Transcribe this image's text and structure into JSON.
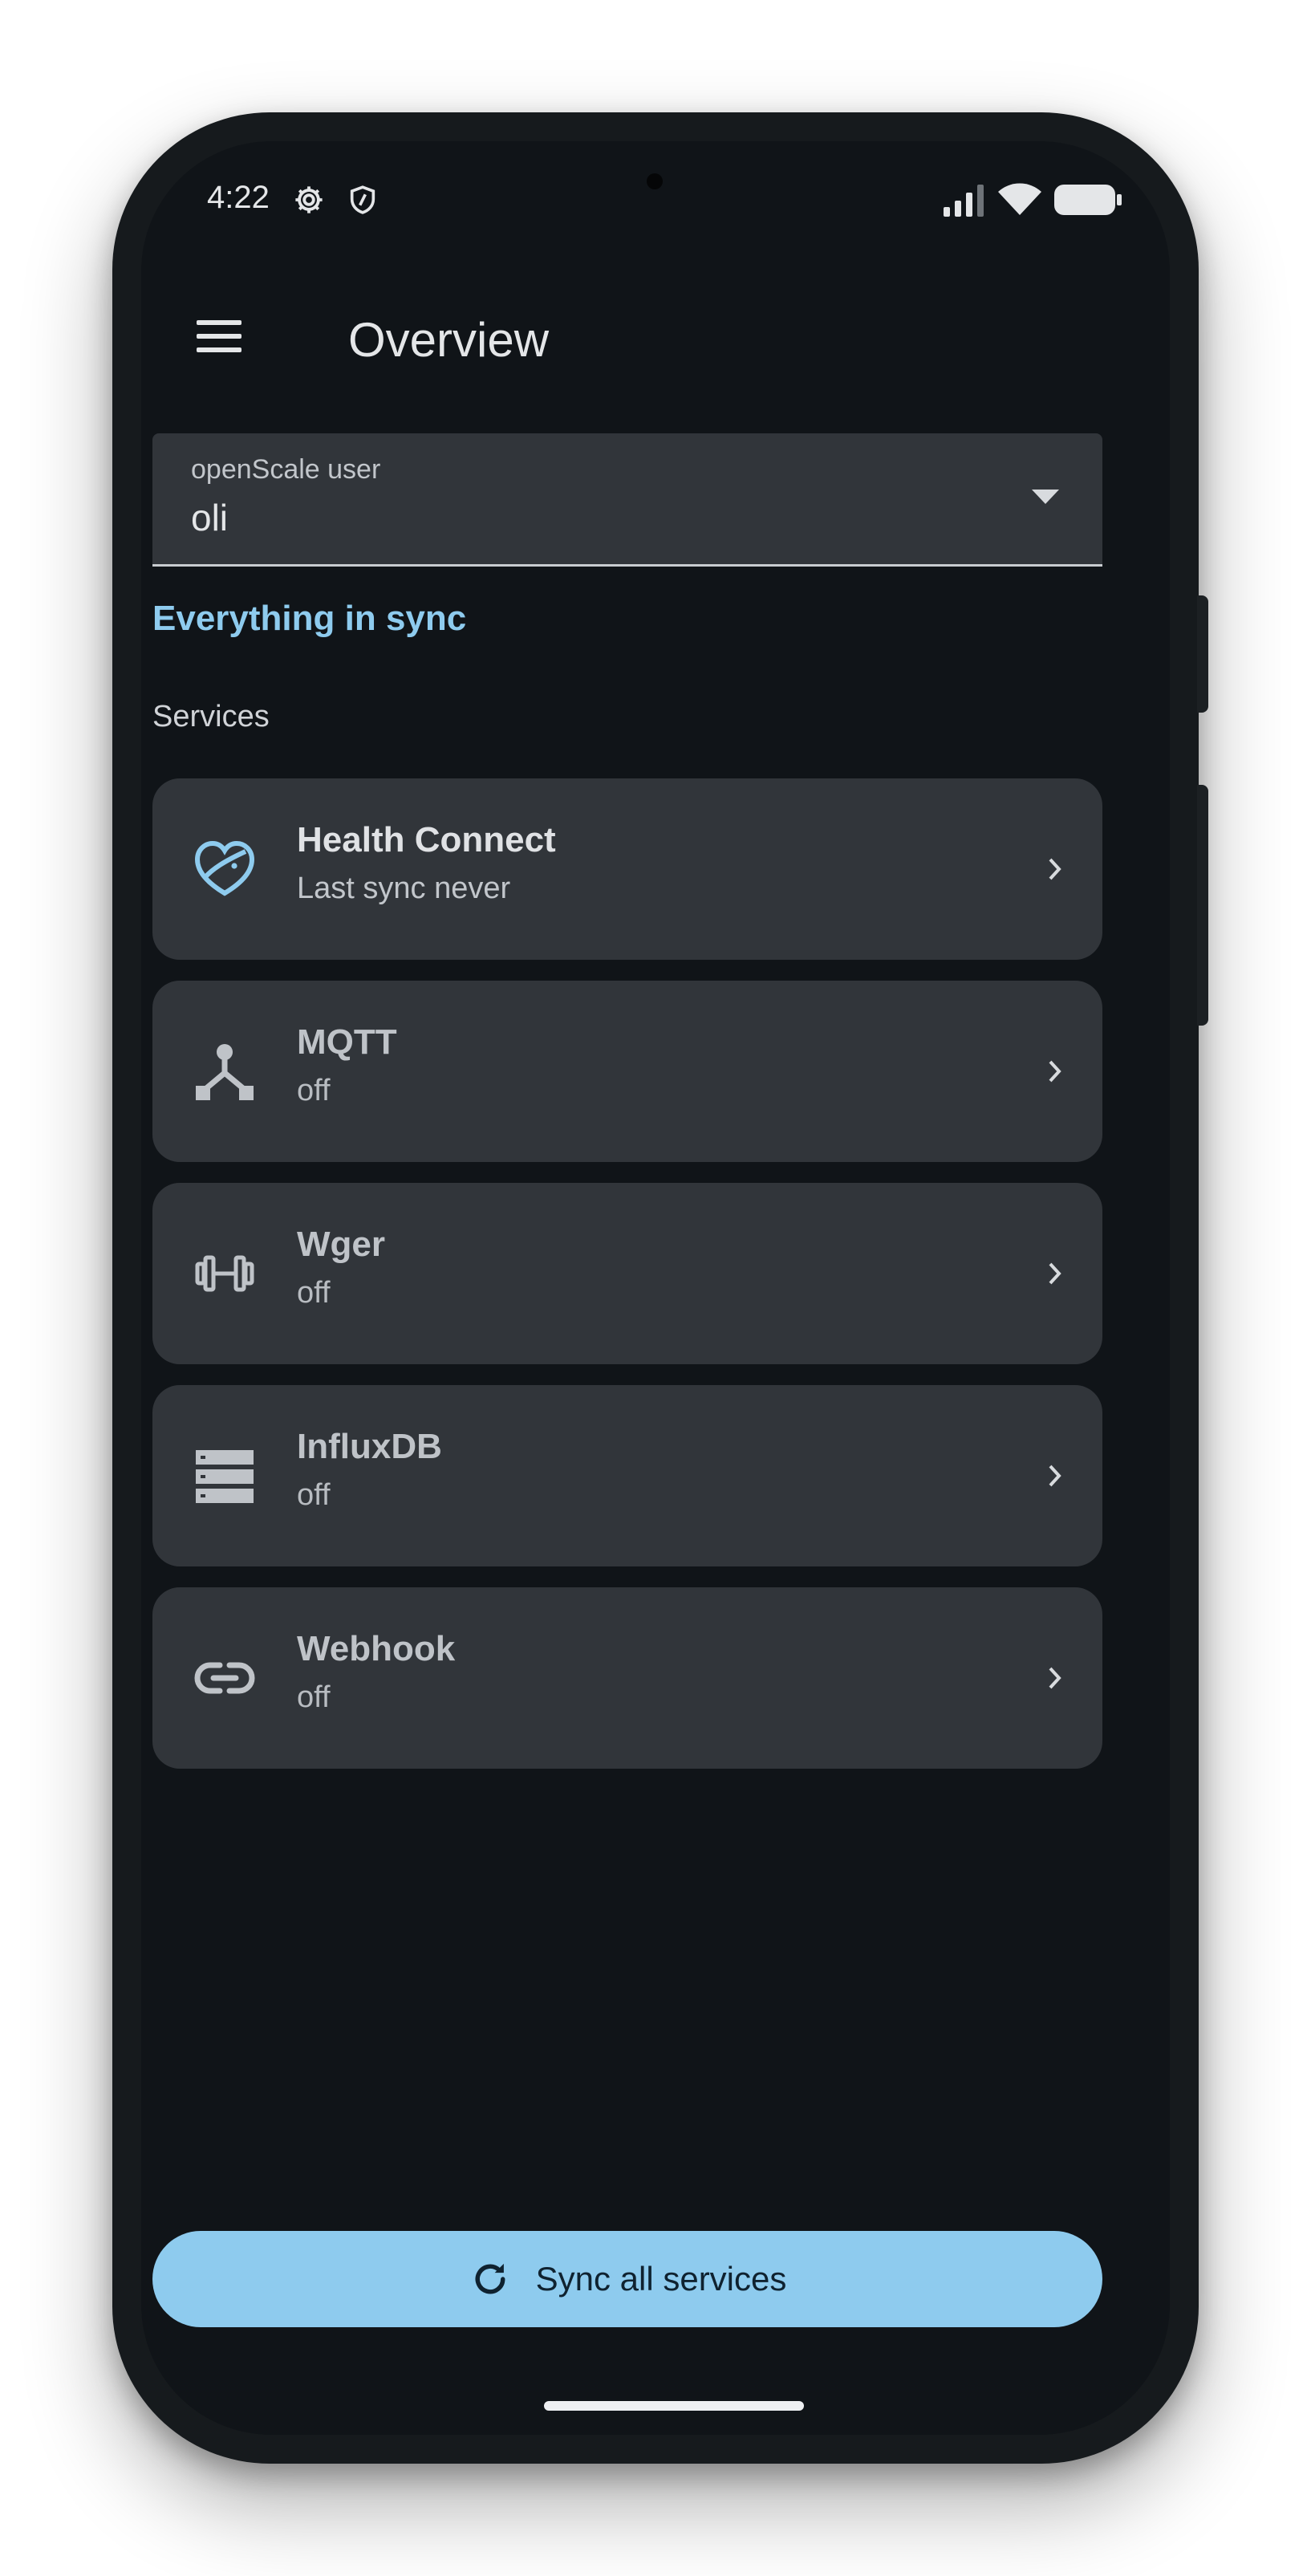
{
  "status_bar": {
    "time": "4:22",
    "icons": [
      "settings-gear-icon",
      "shield-icon",
      "cell-signal-icon",
      "wifi-icon",
      "battery-icon"
    ]
  },
  "header": {
    "menu_icon": "hamburger-menu-icon",
    "title": "Overview"
  },
  "user_select": {
    "label": "openScale user",
    "value": "oli",
    "icon": "dropdown-caret-icon"
  },
  "sync_status": "Everything in sync",
  "services_label": "Services",
  "services": [
    {
      "name": "Health Connect",
      "status": "Last sync never",
      "icon": "health-connect-icon"
    },
    {
      "name": "MQTT",
      "status": "off",
      "icon": "mqtt-hub-icon"
    },
    {
      "name": "Wger",
      "status": "off",
      "icon": "dumbbell-icon"
    },
    {
      "name": "InfluxDB",
      "status": "off",
      "icon": "database-icon"
    },
    {
      "name": "Webhook",
      "status": "off",
      "icon": "link-icon"
    }
  ],
  "sync_button": {
    "label": "Sync all services",
    "icon": "refresh-icon"
  },
  "colors": {
    "background": "#101418",
    "card": "#31353a",
    "accent": "#8ecbee",
    "text": "#e4e6e8"
  }
}
